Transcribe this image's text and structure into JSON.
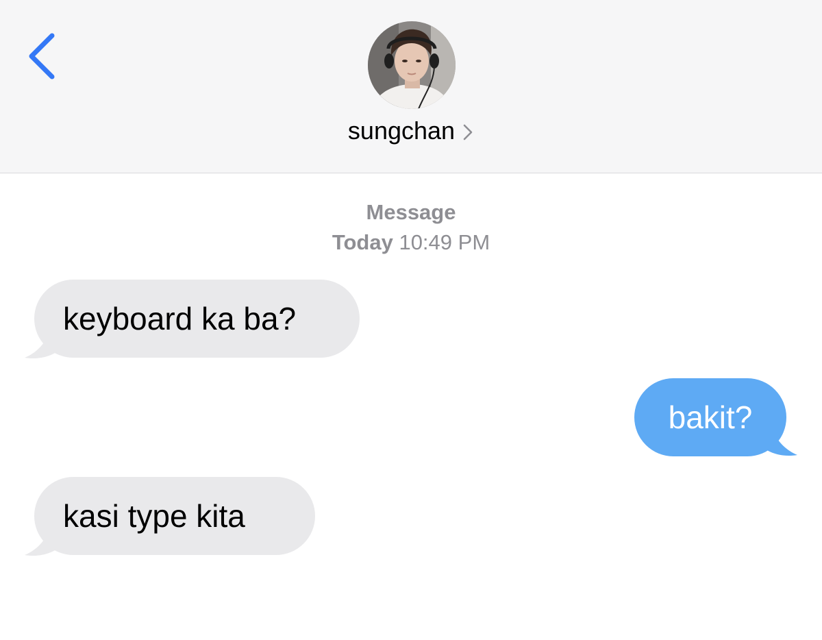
{
  "header": {
    "contact_name": "sungchan",
    "back_icon": "chevron-left-icon",
    "details_icon": "chevron-right-icon"
  },
  "thread": {
    "service_label": "Message",
    "day_label": "Today",
    "time_label": "10:49 PM"
  },
  "messages": [
    {
      "direction": "incoming",
      "text": "keyboard ka ba?"
    },
    {
      "direction": "outgoing",
      "text": "bakit?"
    },
    {
      "direction": "incoming",
      "text": "kasi type kita"
    }
  ],
  "colors": {
    "accent": "#3478f6",
    "incoming_bubble": "#e9e9eb",
    "outgoing_bubble": "#5eaaf4",
    "meta_text": "#8e8e93",
    "header_bg": "#f6f6f7"
  }
}
